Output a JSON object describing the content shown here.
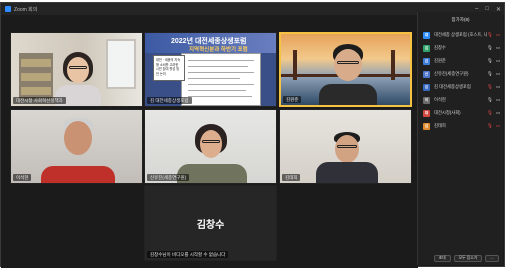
{
  "window": {
    "title": "Zoom 회의"
  },
  "stage": {
    "tiles": [
      {
        "label": "대전시청 사회혁신정책과"
      },
      {
        "label": "김 대전세종상생포럼",
        "headline": "2022년 대전세종상생포럼",
        "subline": "지역혁신분과 하반기 포럼",
        "note": "대전 · 세종의 지속형 소비를 고려한 시민 참여 활성 방안 논의"
      },
      {
        "label": "김원준"
      },
      {
        "label": "이석현"
      },
      {
        "label": "신유진(세종연구원)"
      },
      {
        "label": "김태희"
      },
      {
        "bigname": "김창수",
        "label": "김창수님이 비디오를 시작할 수 없습니다"
      }
    ]
  },
  "participants": {
    "title": "참가자(8)",
    "items": [
      {
        "initial": "대",
        "name": "대전세종 상생포럼 (호스트, 나)",
        "color": "#2d8cff",
        "mic": "🎙",
        "mic_muted": true,
        "cam_off": true
      },
      {
        "initial": "김",
        "name": "김창수",
        "color": "#2fa36b",
        "mic": "🎙",
        "mic_muted": false,
        "cam_off": false
      },
      {
        "initial": "김",
        "name": "김원준",
        "color": "#3b7dd8",
        "mic": "🎙",
        "mic_muted": false,
        "cam_off": false
      },
      {
        "initial": "신",
        "name": "신유진(세종연구원)",
        "color": "#4c74c9",
        "mic": "🎙",
        "mic_muted": false,
        "cam_off": false
      },
      {
        "initial": "김",
        "name": "김 대전세종상생포럼",
        "color": "#3568c0",
        "mic": "🎙",
        "mic_muted": true,
        "cam_off": false
      },
      {
        "initial": "이",
        "name": "이석현",
        "color": "#6b6b6b",
        "mic": "🎙",
        "mic_muted": false,
        "cam_off": false
      },
      {
        "initial": "대",
        "name": "대전시청(사회)",
        "color": "#d1493f",
        "mic": "🎙",
        "mic_muted": true,
        "cam_off": false
      },
      {
        "initial": "김",
        "name": "김태희",
        "color": "#e08a2e",
        "mic": "🎙",
        "mic_muted": true,
        "cam_off": true
      }
    ],
    "invite_label": "초대",
    "mute_all_label": "모두 음소거",
    "more_label": "···"
  }
}
